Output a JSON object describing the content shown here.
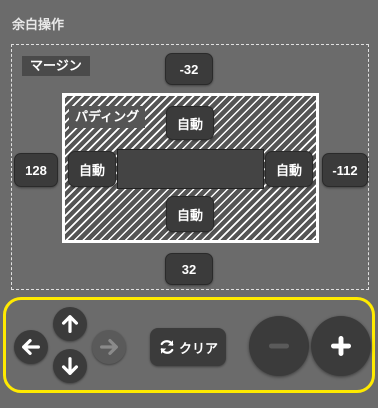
{
  "panel": {
    "title": "余白操作"
  },
  "margin": {
    "label": "マージン",
    "top": "-32",
    "left": "128",
    "right": "-112",
    "bottom": "32"
  },
  "padding": {
    "label": "パディング",
    "top": "自動",
    "left": "自動",
    "right": "自動",
    "bottom": "自動"
  },
  "controls": {
    "clear_label": "クリア",
    "icons": [
      "arrow-up-icon",
      "arrow-left-icon",
      "arrow-right-icon",
      "arrow-down-icon",
      "refresh-icon",
      "minus-icon",
      "plus-icon"
    ],
    "highlight_color": "#ffea00"
  }
}
